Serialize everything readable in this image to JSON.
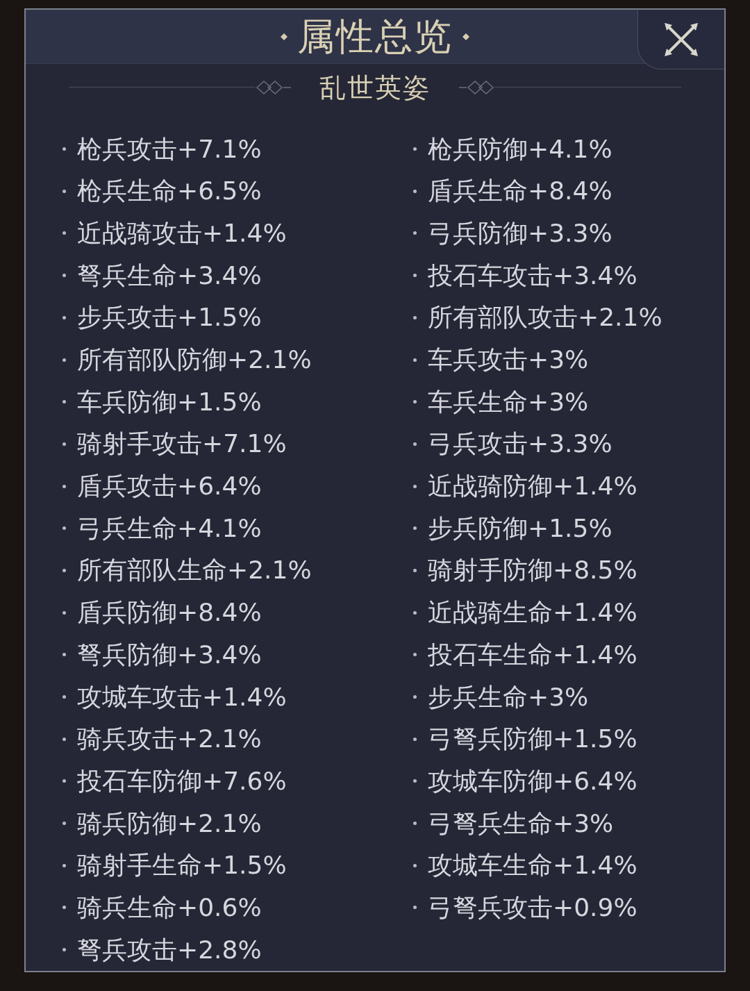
{
  "dialog": {
    "title": "属性总览",
    "section": {
      "title": "乱世英姿",
      "attributes": [
        "枪兵攻击+7.1%",
        "枪兵防御+4.1%",
        "枪兵生命+6.5%",
        "盾兵生命+8.4%",
        "近战骑攻击+1.4%",
        "弓兵防御+3.3%",
        "弩兵生命+3.4%",
        "投石车攻击+3.4%",
        "步兵攻击+1.5%",
        "所有部队攻击+2.1%",
        "所有部队防御+2.1%",
        "车兵攻击+3%",
        "车兵防御+1.5%",
        "车兵生命+3%",
        "骑射手攻击+7.1%",
        "弓兵攻击+3.3%",
        "盾兵攻击+6.4%",
        "近战骑防御+1.4%",
        "弓兵生命+4.1%",
        "步兵防御+1.5%",
        "所有部队生命+2.1%",
        "骑射手防御+8.5%",
        "盾兵防御+8.4%",
        "近战骑生命+1.4%",
        "弩兵防御+3.4%",
        "投石车生命+1.4%",
        "攻城车攻击+1.4%",
        "步兵生命+3%",
        "骑兵攻击+2.1%",
        "弓弩兵防御+1.5%",
        "投石车防御+7.6%",
        "攻城车防御+6.4%",
        "骑兵防御+2.1%",
        "弓弩兵生命+3%",
        "骑射手生命+1.5%",
        "攻城车生命+1.4%",
        "骑兵生命+0.6%",
        "弓弩兵攻击+0.9%",
        "弩兵攻击+2.8%"
      ]
    }
  }
}
